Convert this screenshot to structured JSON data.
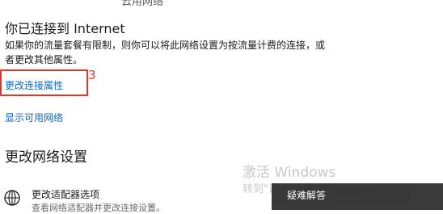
{
  "top_fragment": "云用网络",
  "status": {
    "heading": "你已连接到 Internet",
    "description": "如果你的流量套餐有限制，则你可以将此网络设置为按流量计费的连接，或者更改其他属性。"
  },
  "links": {
    "change_connection_properties": "更改连接属性",
    "show_available_networks": "显示可用网络"
  },
  "annotation": {
    "number": "3",
    "color": "#d93a2b"
  },
  "change_settings": {
    "heading": "更改网络设置",
    "adapter_option": {
      "icon": "network-adapter-icon",
      "title": "更改适配器选项",
      "description": "查看网络适配器并更改连接设置。"
    }
  },
  "watermark": {
    "title": "激活 Windows",
    "subtitle": "转到\"设置\"以激活 Windows。"
  },
  "tooltip": {
    "label": "疑难解答"
  },
  "colors": {
    "link": "#1366b8",
    "text": "#1a1a1a",
    "annotation": "#d93a2b",
    "tooltip_bg": "#2b2b2b"
  }
}
